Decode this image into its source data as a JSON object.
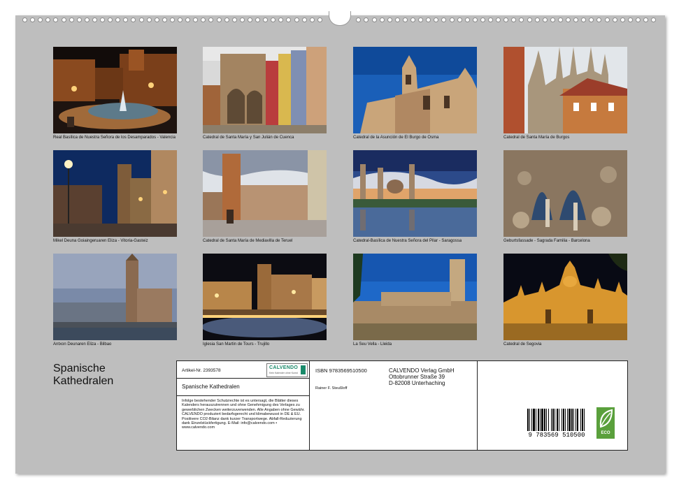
{
  "calendar": {
    "title_line1": "Spanische",
    "title_line2": "Kathedralen",
    "photos": [
      {
        "caption": "Real Basílica de Nuestra Señora de los Desamparados - Valencia",
        "scene": "night-plaza-fountain"
      },
      {
        "caption": "Catedral de Santa María y San Julián de Cuenca",
        "scene": "day-cathedral-colorful-houses"
      },
      {
        "caption": "Catedral de la Asunción de El Burgo de Osma",
        "scene": "blue-sky-cathedral"
      },
      {
        "caption": "Catedral de Santa María de Burgos",
        "scene": "gothic-spires"
      },
      {
        "caption": "Mikel Deuna Goiaingeruaren Eliza - Vitoria-Gasteiz",
        "scene": "night-street-lamp"
      },
      {
        "caption": "Catedral de Santa María de Mediavilla de Teruel",
        "scene": "mudejar-tower-square"
      },
      {
        "caption": "Catedral-Basílica de Nuestra Señora del Pilar - Saragossa",
        "scene": "river-reflection-dusk"
      },
      {
        "caption": "Geburtsfassade - Sagrada Familia - Barcelona",
        "scene": "stone-facade-detail"
      },
      {
        "caption": "Antxon Deunaren Eliza - Bilbao",
        "scene": "dusk-riverside-church"
      },
      {
        "caption": "Iglesia San Martin de Tours - Trujillo",
        "scene": "night-plaza-church"
      },
      {
        "caption": "La Seu Vella - Lleida",
        "scene": "blue-sky-fortress-tower"
      },
      {
        "caption": "Catedral de Segovia",
        "scene": "night-lit-cathedral"
      }
    ]
  },
  "info": {
    "article_no": "Artikel-Nr. 2393578",
    "calvendo_logo": "CALVENDO",
    "logo_tagline": "Kein Kalender ohne Kunst",
    "product_title": "Spanische Kathedralen",
    "legal_text": "Infolge bestehender Schutzrechte ist es untersagt, die Blätter dieses Kalenders herauszutrennen und ohne Genehmigung des Verlages zu gewerblichen Zwecken weiterzuverwenden. Alle Angaben ohne Gewähr. CALVENDO produziert bedarfsgerecht und klimabewusst in DE & EU. Positivere CO2-Bilanz dank kurzer Transportwege. Abfall-Reduzierung dank Einzelstückfertigung. E-Mail: info@calvendo.com • www.calvendo.com",
    "isbn": "ISBN 9783569510500",
    "author": "Rainer F. Steußloff",
    "publisher_line1": "CALVENDO Verlag GmbH",
    "publisher_line2": "Ottobrunner Straße 39",
    "publisher_line3": "D-82008 Unterhaching",
    "barcode_number": "9 783569 510500",
    "eco_label": "ECO"
  }
}
